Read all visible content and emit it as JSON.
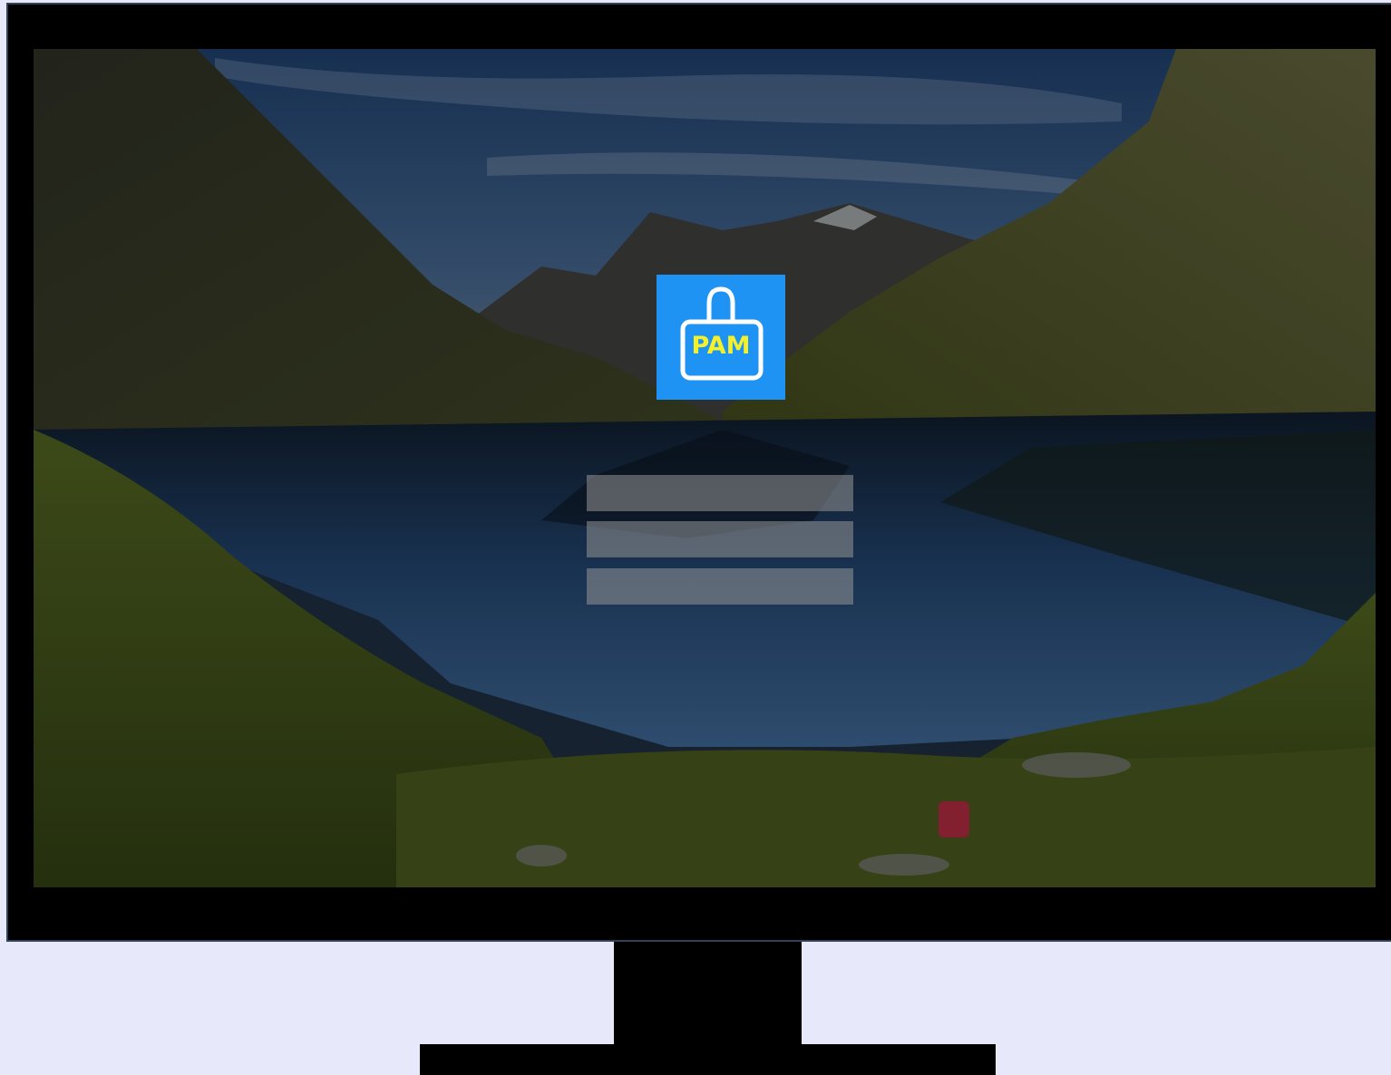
{
  "login": {
    "logo_text": "PAM",
    "field1": {
      "value": "",
      "placeholder": ""
    },
    "field2": {
      "value": "",
      "placeholder": ""
    },
    "button": {
      "label": ""
    }
  },
  "colors": {
    "logo_background": "#1e93f3",
    "logo_text": "#f4f12a",
    "page_background": "#e8e8fb",
    "monitor_frame": "#000000"
  },
  "icons": {
    "logo": "padlock-icon"
  }
}
